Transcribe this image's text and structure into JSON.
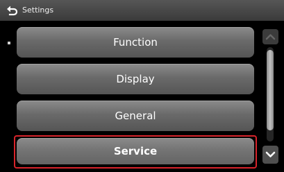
{
  "header": {
    "title": "Settings",
    "back_icon": "back-arrow-icon"
  },
  "menu": {
    "items": [
      {
        "label": "Function"
      },
      {
        "label": "Display"
      },
      {
        "label": "General"
      },
      {
        "label": "Service",
        "highlighted": true
      }
    ]
  },
  "scrollbar": {
    "up_icon": "chevron-up-icon",
    "down_icon": "chevron-down-icon"
  },
  "colors": {
    "background": "#000000",
    "button": "#6a6a6a",
    "highlight": "#d8242b"
  }
}
